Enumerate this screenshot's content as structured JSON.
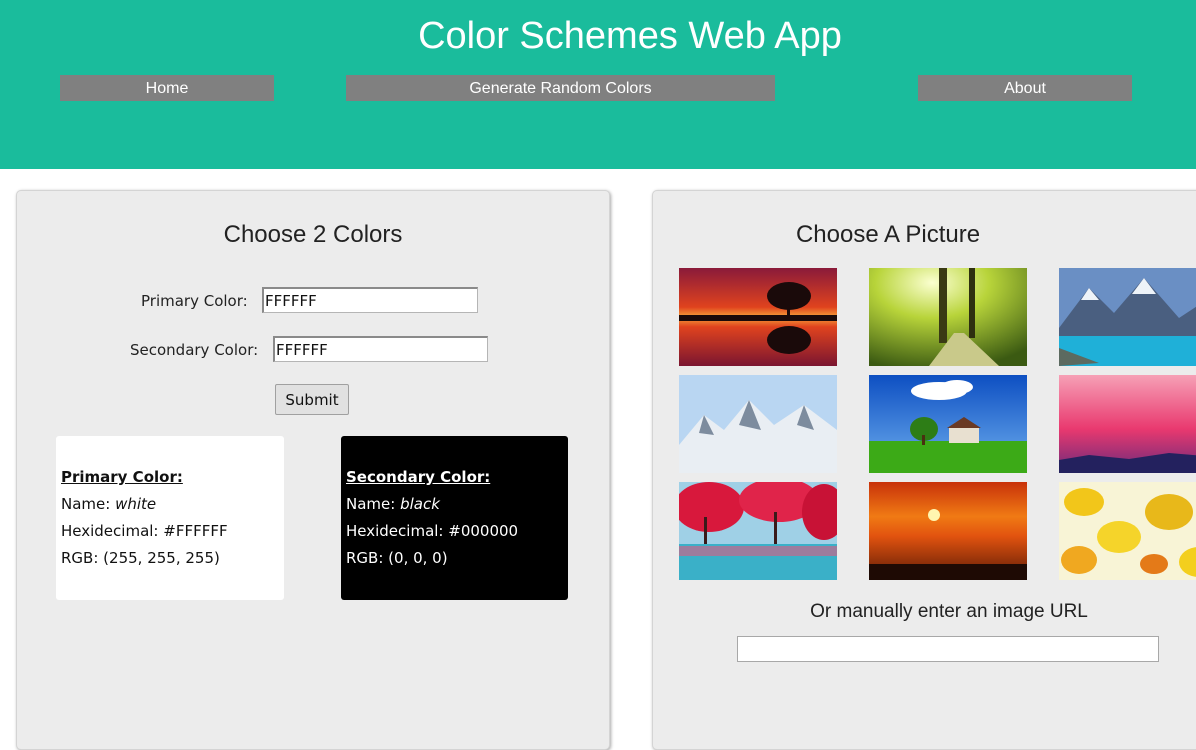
{
  "header": {
    "title": "Color Schemes Web App",
    "background": "#1abc9c",
    "nav": {
      "home": "Home",
      "random": "Generate Random Colors",
      "about": "About"
    },
    "nav_color": "#808080"
  },
  "colors_panel": {
    "title": "Choose 2 Colors",
    "primary_label": "Primary Color:",
    "primary_value": "FFFFFF",
    "secondary_label": "Secondary Color:",
    "secondary_value": "FFFFFF",
    "submit_label": "Submit",
    "primary_card": {
      "heading": "Primary Color: ",
      "name_label": "Name: ",
      "name_value": "white",
      "hex_label": "Hexidecimal: ",
      "hex_value": "#FFFFFF",
      "rgb_label": "RGB: ",
      "rgb_value": "(255, 255, 255)",
      "background": "#ffffff"
    },
    "secondary_card": {
      "heading": "Secondary Color: ",
      "name_label": "Name: ",
      "name_value": "black",
      "hex_label": "Hexidecimal: ",
      "hex_value": "#000000",
      "rgb_label": "RGB: ",
      "rgb_value": "(0, 0, 0)",
      "background": "#000000"
    }
  },
  "picture_panel": {
    "title": "Choose A Picture",
    "images": [
      {
        "name": "sunset-tree-reflection-thumbnail",
        "colors": [
          "#d9261c",
          "#f28c2a"
        ]
      },
      {
        "name": "sunlit-forest-path-thumbnail",
        "colors": [
          "#6e8f1c",
          "#e6f08a"
        ]
      },
      {
        "name": "mountain-lake-thumbnail",
        "colors": [
          "#3a6fb0",
          "#27b4d6"
        ]
      },
      {
        "name": "snowy-mountains-thumbnail",
        "colors": [
          "#a9c9ea",
          "#eef2f6"
        ]
      },
      {
        "name": "green-field-house-thumbnail",
        "colors": [
          "#1d5fc8",
          "#3fae1c"
        ]
      },
      {
        "name": "pink-sky-hills-thumbnail",
        "colors": [
          "#f07ba0",
          "#2c2a6e"
        ]
      },
      {
        "name": "red-trees-water-thumbnail",
        "colors": [
          "#d81e3e",
          "#3aa9c4"
        ]
      },
      {
        "name": "orange-sunset-sea-thumbnail",
        "colors": [
          "#e2530f",
          "#ffd23a"
        ]
      },
      {
        "name": "autumn-leaves-thumbnail",
        "colors": [
          "#f3d21e",
          "#f6f0c8"
        ]
      }
    ],
    "url_label": "Or manually enter an image URL",
    "url_value": ""
  }
}
